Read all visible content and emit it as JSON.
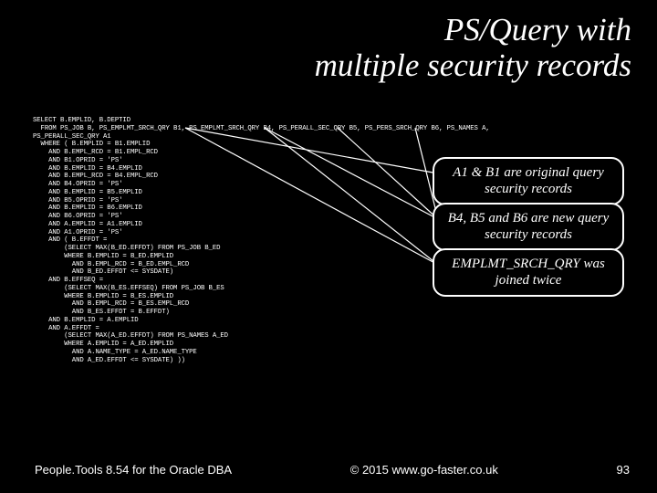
{
  "title_line1": "PS/Query with",
  "title_line2": "multiple security records",
  "sql": "SELECT B.EMPLID, B.DEPTID\n  FROM PS_JOB B, PS_EMPLMT_SRCH_QRY B1, PS_EMPLMT_SRCH_QRY B4, PS_PERALL_SEC_QRY B5, PS_PERS_SRCH_QRY B6, PS_NAMES A,\nPS_PERALL_SEC_QRY A1\n  WHERE ( B.EMPLID = B1.EMPLID\n    AND B.EMPL_RCD = B1.EMPL_RCD\n    AND B1.OPRID = 'PS'\n    AND B.EMPLID = B4.EMPLID\n    AND B.EMPL_RCD = B4.EMPL_RCD\n    AND B4.OPRID = 'PS'\n    AND B.EMPLID = B5.EMPLID\n    AND B5.OPRID = 'PS'\n    AND B.EMPLID = B6.EMPLID\n    AND B6.OPRID = 'PS'\n    AND A.EMPLID = A1.EMPLID\n    AND A1.OPRID = 'PS'\n    AND ( B.EFFDT =\n        (SELECT MAX(B_ED.EFFDT) FROM PS_JOB B_ED\n        WHERE B.EMPLID = B_ED.EMPLID\n          AND B.EMPL_RCD = B_ED.EMPL_RCD\n          AND B_ED.EFFDT <= SYSDATE)\n    AND B.EFFSEQ =\n        (SELECT MAX(B_ES.EFFSEQ) FROM PS_JOB B_ES\n        WHERE B.EMPLID = B_ES.EMPLID\n          AND B.EMPL_RCD = B_ES.EMPL_RCD\n          AND B_ES.EFFDT = B.EFFDT)\n    AND B.EMPLID = A.EMPLID\n    AND A.EFFDT =\n        (SELECT MAX(A_ED.EFFDT) FROM PS_NAMES A_ED\n        WHERE A.EMPLID = A_ED.EMPLID\n          AND A.NAME_TYPE = A_ED.NAME_TYPE\n          AND A_ED.EFFDT <= SYSDATE) ))",
  "callouts": {
    "c1": "A1 & B1 are original query security records",
    "c2": "B4, B5 and B6 are new query security records",
    "c3": "EMPLMT_SRCH_QRY was joined twice"
  },
  "footer": {
    "left": "People.Tools 8.54 for the Oracle DBA",
    "center": "© 2015 www.go-faster.co.uk",
    "right": "93"
  }
}
